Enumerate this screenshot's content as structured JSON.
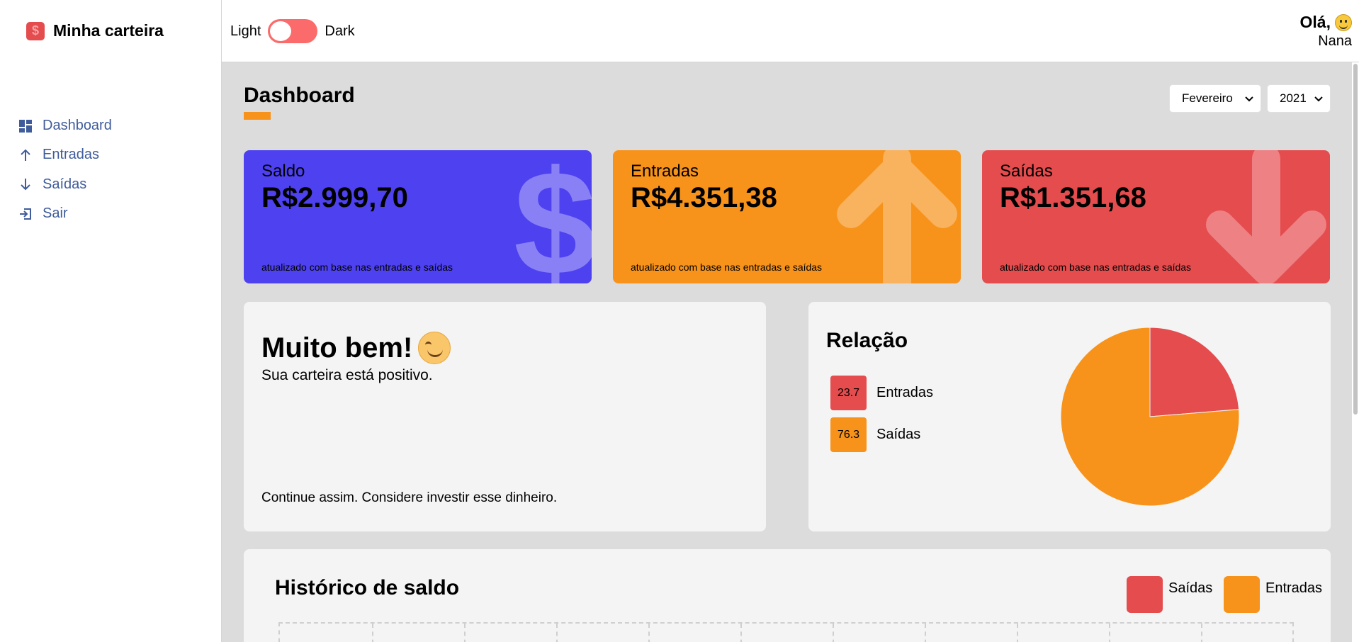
{
  "app": {
    "name": "Minha carteira",
    "logo_symbol": "$"
  },
  "sidebar": {
    "items": [
      {
        "label": "Dashboard",
        "icon": "dashboard-icon"
      },
      {
        "label": "Entradas",
        "icon": "arrow-up-icon"
      },
      {
        "label": "Saídas",
        "icon": "arrow-down-icon"
      },
      {
        "label": "Sair",
        "icon": "logout-icon"
      }
    ]
  },
  "header": {
    "theme_light": "Light",
    "theme_dark": "Dark",
    "greeting": "Olá,",
    "user_name": "Nana"
  },
  "page": {
    "title": "Dashboard",
    "month": "Fevereiro",
    "year": "2021"
  },
  "cards": [
    {
      "title": "Saldo",
      "value": "R$2.999,70",
      "footer": "atualizado com base nas entradas e saídas",
      "color": "#4e41f0",
      "icon": "dollar-icon"
    },
    {
      "title": "Entradas",
      "value": "R$4.351,38",
      "footer": "atualizado com base nas entradas e saídas",
      "color": "#f7931b",
      "icon": "arrow-up-icon"
    },
    {
      "title": "Saídas",
      "value": "R$1.351,68",
      "footer": "atualizado com base nas entradas e saídas",
      "color": "#e44c4e",
      "icon": "arrow-down-icon"
    }
  ],
  "message": {
    "title": "Muito bem!",
    "subtitle": "Sua carteira está positivo.",
    "footer": "Continue assim. Considere investir esse dinheiro."
  },
  "relation": {
    "title": "Relação",
    "legend": [
      {
        "value": "23.7",
        "label": "Entradas",
        "color": "#e44c4e"
      },
      {
        "value": "76.3",
        "label": "Saídas",
        "color": "#f7931b"
      }
    ]
  },
  "history": {
    "title": "Histórico de saldo",
    "legend": [
      {
        "label": "Saídas",
        "color": "#e44c4e"
      },
      {
        "label": "Entradas",
        "color": "#f7931b"
      }
    ]
  },
  "chart_data": {
    "type": "pie",
    "categories": [
      "Entradas",
      "Saídas"
    ],
    "values": [
      23.7,
      76.3
    ],
    "colors": [
      "#e44c4e",
      "#f7931b"
    ]
  }
}
